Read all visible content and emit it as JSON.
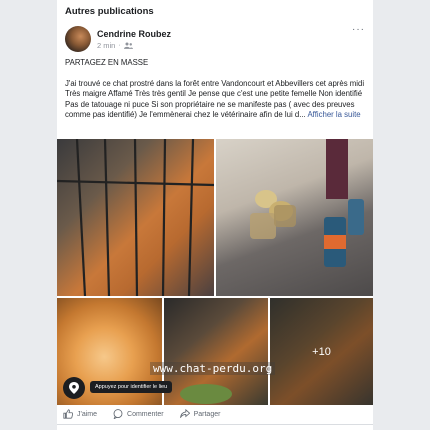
{
  "section": {
    "title": "Autres publications"
  },
  "post": {
    "author": "Cendrine Roubez",
    "time": "2 min",
    "separator": "·",
    "more_label": "···",
    "heading": "PARTAGEZ EN MASSE",
    "body": "J'ai trouvé ce chat prostré dans la forêt entre Vandoncourt et Abbevillers cet après midi Très maigre Affamé Très très gentil Je pense que c'est une petite femelle Non identifié Pas de tatouage ni puce Si son propriétaire ne se manifeste pas ( avec des preuves comme pas identifié) Je l'emmènerai chez le vétérinaire afin de lui d...",
    "see_more": "Afficher la suite"
  },
  "photos": {
    "more_count": "+10",
    "watermark": "www.chat-perdu.org",
    "location_tip": "Appuyez pour identifier le lieu"
  },
  "actions": {
    "like": "J'aime",
    "comment": "Commenter",
    "share": "Partager"
  },
  "icons": [
    "more-icon",
    "friends-icon",
    "location-pin-icon",
    "like-icon",
    "comment-icon",
    "share-icon"
  ]
}
